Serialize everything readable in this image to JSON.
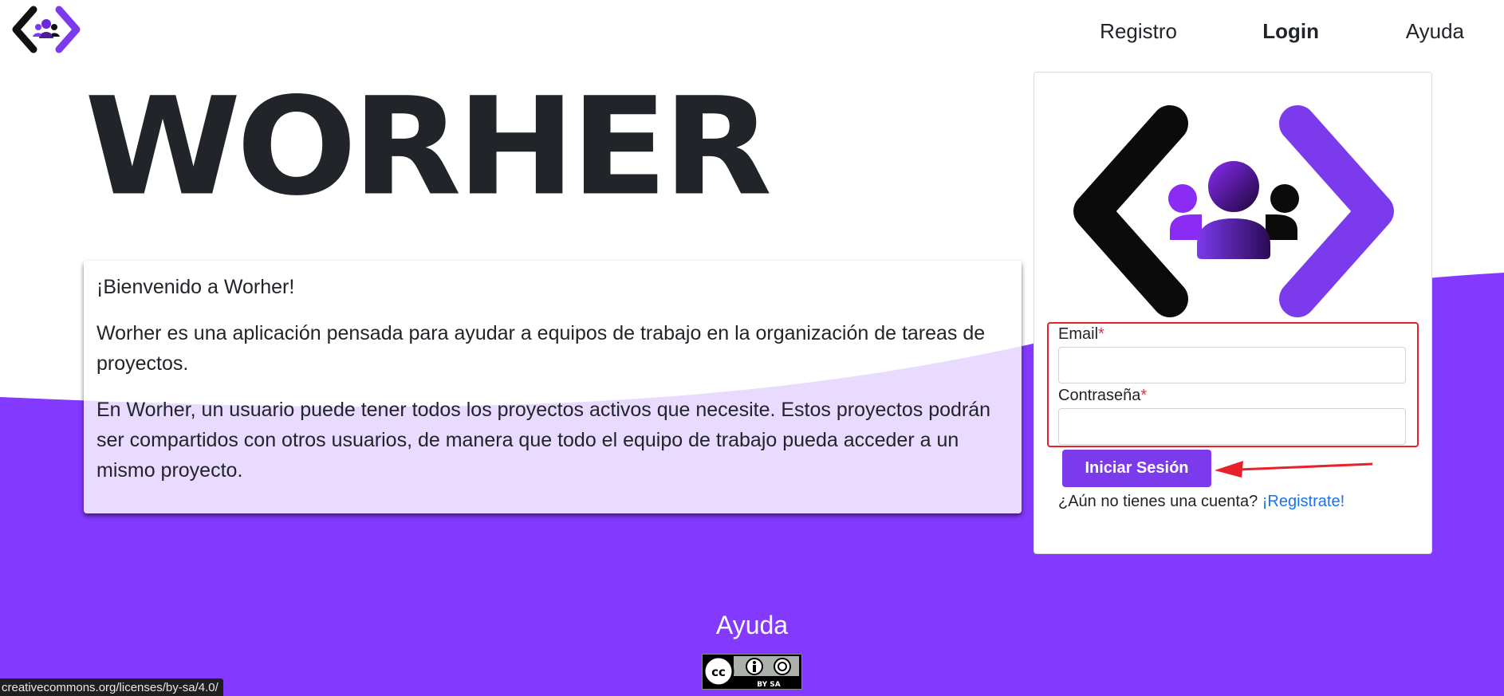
{
  "colors": {
    "brand_purple": "#7c3aed",
    "band_purple": "#8339ff",
    "required_red": "#dc3545",
    "highlight_red": "#e8202a",
    "link_blue": "#1a73e8",
    "text_dark": "#212529"
  },
  "header": {
    "logo_icon": "worher-logo-icon",
    "nav": [
      {
        "label": "Registro",
        "active": false
      },
      {
        "label": "Login",
        "active": true
      },
      {
        "label": "Ayuda",
        "active": false
      }
    ]
  },
  "brand": {
    "title": "WORHER"
  },
  "welcome": {
    "greeting": "¡Bienvenido a Worher!",
    "intro": "Worher es una aplicación pensada para ayudar a equipos de trabajo en la organización de tareas de proyectos.",
    "details": "En Worher, un usuario puede tener todos los proyectos activos que necesite. Estos proyectos podrán ser compartidos con otros usuarios, de manera que todo el equipo de trabajo pueda acceder a un mismo proyecto."
  },
  "login": {
    "logo_icon": "worher-logo-large",
    "email_label": "Email",
    "email_value": "",
    "password_label": "Contraseña",
    "password_value": "",
    "required_mark": "*",
    "submit_label": "Iniciar Sesión",
    "register_prompt": "¿Aún no tienes una cuenta?",
    "register_link": "¡Registrate!"
  },
  "footer": {
    "help_link": "Ayuda",
    "license_badge": "cc-by-sa-icon",
    "license_badge_text": "BY  SA"
  },
  "status_bar": {
    "url": "creativecommons.org/licenses/by-sa/4.0/"
  }
}
